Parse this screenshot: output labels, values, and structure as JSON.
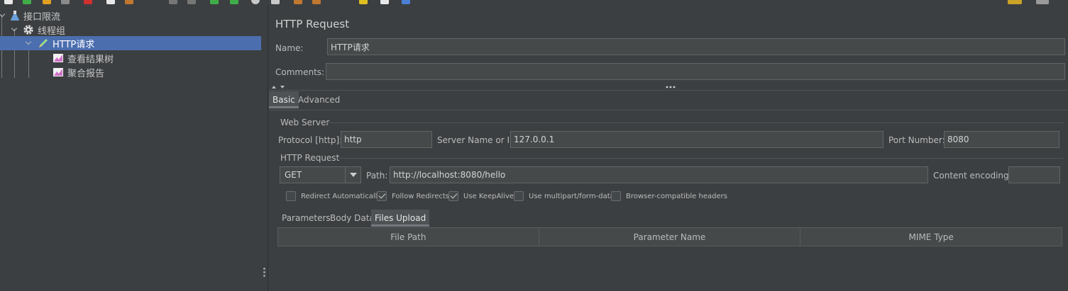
{
  "tree": {
    "items": [
      {
        "label": "接口限流"
      },
      {
        "label": "线程组"
      },
      {
        "label": "HTTP请求"
      },
      {
        "label": "查看结果树"
      },
      {
        "label": "聚合报告"
      }
    ]
  },
  "panel": {
    "title": "HTTP Request",
    "name_label": "Name:",
    "name_value": "HTTP请求",
    "comments_label": "Comments:",
    "comments_value": ""
  },
  "tabs": {
    "basic": "Basic",
    "advanced": "Advanced"
  },
  "web_server": {
    "title": "Web Server",
    "protocol_label": "Protocol [http]:",
    "protocol_value": "http",
    "server_label": "Server Name or IP:",
    "server_value": "127.0.0.1",
    "port_label": "Port Number:",
    "port_value": "8080"
  },
  "http_request": {
    "title": "HTTP Request",
    "method": "GET",
    "path_label": "Path:",
    "path_value": "http://localhost:8080/hello",
    "encoding_label": "Content encoding:",
    "encoding_value": ""
  },
  "options": [
    {
      "label": "Redirect Automatically",
      "checked": false
    },
    {
      "label": "Follow Redirects",
      "checked": true
    },
    {
      "label": "Use KeepAlive",
      "checked": true
    },
    {
      "label": "Use multipart/form-data",
      "checked": false
    },
    {
      "label": "Browser-compatible headers",
      "checked": false
    }
  ],
  "sub_tabs": {
    "parameters": "Parameters",
    "body_data": "Body Data",
    "files_upload": "Files Upload"
  },
  "files_table": {
    "columns": [
      "File Path",
      "Parameter Name",
      "MIME Type"
    ]
  },
  "colors": {
    "background": "#3c3f41",
    "selection": "#4b6eaf",
    "field": "#45494a"
  }
}
